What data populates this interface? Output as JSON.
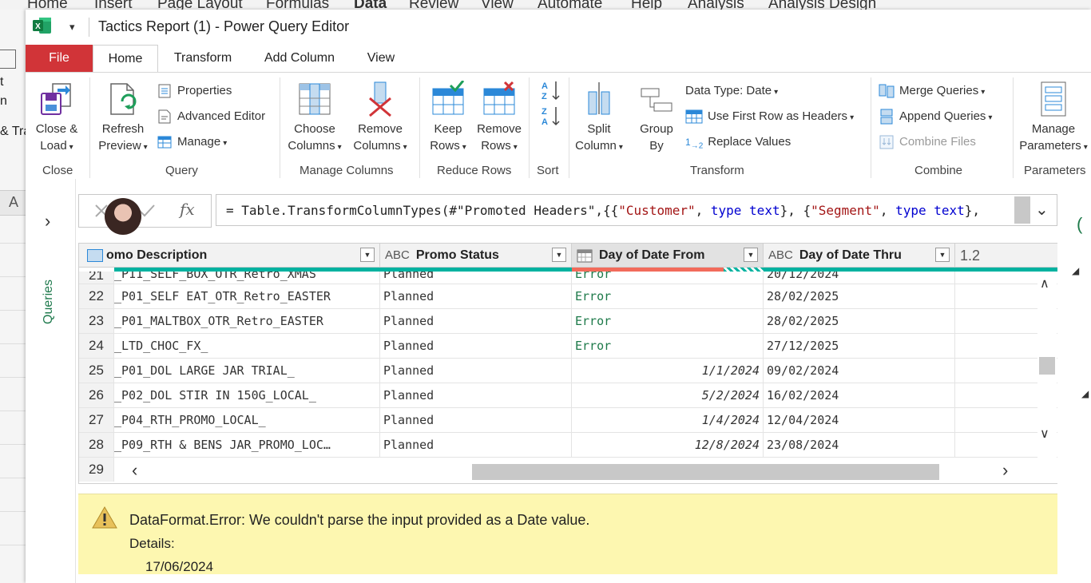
{
  "excel_bg": {
    "tabs": [
      "Home",
      "Insert",
      "Page Layout",
      "Formulas",
      "Data",
      "Review",
      "View",
      "Automate",
      "Help",
      "Analysis",
      "Analysis Design"
    ],
    "left_fragments": [
      "t",
      "n",
      "& Tra",
      "A"
    ]
  },
  "window": {
    "title": "Tactics Report (1) - Power Query Editor"
  },
  "tabs": {
    "file": "File",
    "home": "Home",
    "transform": "Transform",
    "add_column": "Add Column",
    "view": "View"
  },
  "ribbon": {
    "close": {
      "btn_line1": "Close &",
      "btn_line2": "Load",
      "label": "Close"
    },
    "query": {
      "refresh_line1": "Refresh",
      "refresh_line2": "Preview",
      "properties": "Properties",
      "advanced_editor": "Advanced Editor",
      "manage": "Manage",
      "label": "Query"
    },
    "manage_columns": {
      "choose_line1": "Choose",
      "choose_line2": "Columns",
      "remove_line1": "Remove",
      "remove_line2": "Columns",
      "label": "Manage Columns"
    },
    "reduce_rows": {
      "keep_line1": "Keep",
      "keep_line2": "Rows",
      "remove_line1": "Remove",
      "remove_line2": "Rows",
      "label": "Reduce Rows"
    },
    "sort": {
      "label": "Sort"
    },
    "transform": {
      "split_line1": "Split",
      "split_line2": "Column",
      "group_line1": "Group",
      "group_line2": "By",
      "data_type": "Data Type: Date",
      "first_row": "Use First Row as Headers",
      "replace_values": "Replace Values",
      "label": "Transform"
    },
    "combine": {
      "merge": "Merge Queries",
      "append": "Append Queries",
      "combine_files": "Combine Files",
      "label": "Combine"
    },
    "parameters": {
      "manage_line1": "Manage",
      "manage_line2": "Parameters",
      "label": "Parameters"
    }
  },
  "queries_pane": {
    "label": "Queries"
  },
  "formula": {
    "fx": "fx",
    "p1": "= Table.TransformColumnTypes(#\"Promoted Headers\",{{",
    "s1": "\"Customer\"",
    "p2": ", ",
    "k1": "type",
    "p3": " ",
    "k2": "text",
    "p4": "}, {",
    "s2": "\"Segment\"",
    "p5": ", ",
    "k3": "type",
    "p6": " ",
    "k4": "text",
    "p7": "},"
  },
  "grid": {
    "columns": [
      {
        "name": "omo Description",
        "type": ""
      },
      {
        "name": "Promo Status",
        "type": "ABC"
      },
      {
        "name": "Day of Date From",
        "type": ""
      },
      {
        "name": "Day of Date Thru",
        "type": "ABC"
      },
      {
        "name": "",
        "type": "1.2"
      }
    ],
    "rows": [
      {
        "n": "21",
        "desc": "_P11_SELF_BOX_OTR_Retro_XMAS",
        "status": "Planned",
        "from": "Error",
        "from_err": true,
        "thru": "20/12/2024"
      },
      {
        "n": "22",
        "desc": "_P01_SELF EAT_OTR_Retro_EASTER",
        "status": "Planned",
        "from": "Error",
        "from_err": true,
        "thru": "28/02/2025"
      },
      {
        "n": "23",
        "desc": "_P01_MALTBOX_OTR_Retro_EASTER",
        "status": "Planned",
        "from": "Error",
        "from_err": true,
        "thru": "28/02/2025"
      },
      {
        "n": "24",
        "desc": "_LTD_CHOC_FX_",
        "status": "Planned",
        "from": "Error",
        "from_err": true,
        "thru": "27/12/2025"
      },
      {
        "n": "25",
        "desc": "_P01_DOL LARGE JAR TRIAL_",
        "status": "Planned",
        "from": "1/1/2024",
        "from_err": false,
        "thru": "09/02/2024"
      },
      {
        "n": "26",
        "desc": "_P02_DOL STIR IN 150G_LOCAL_",
        "status": "Planned",
        "from": "5/2/2024",
        "from_err": false,
        "thru": "16/02/2024"
      },
      {
        "n": "27",
        "desc": "_P04_RTH_PROMO_LOCAL_",
        "status": "Planned",
        "from": "1/4/2024",
        "from_err": false,
        "thru": "12/04/2024"
      },
      {
        "n": "28",
        "desc": "_P09_RTH & BENS JAR_PROMO_LOC…",
        "status": "Planned",
        "from": "12/8/2024",
        "from_err": false,
        "thru": "23/08/2024"
      },
      {
        "n": "29",
        "desc": "",
        "status": "",
        "from": "",
        "from_err": false,
        "thru": ""
      }
    ]
  },
  "error": {
    "message": "DataFormat.Error: We couldn't parse the input provided as a Date value.",
    "details_label": "Details:",
    "details_value": "17/06/2024"
  },
  "colors": {
    "file_tab": "#d13438",
    "excel_green": "#1e7a4a",
    "error_bg": "#fdf7b0",
    "quality_bar": "#00b2a0",
    "error_bar": "#f26b5b"
  }
}
